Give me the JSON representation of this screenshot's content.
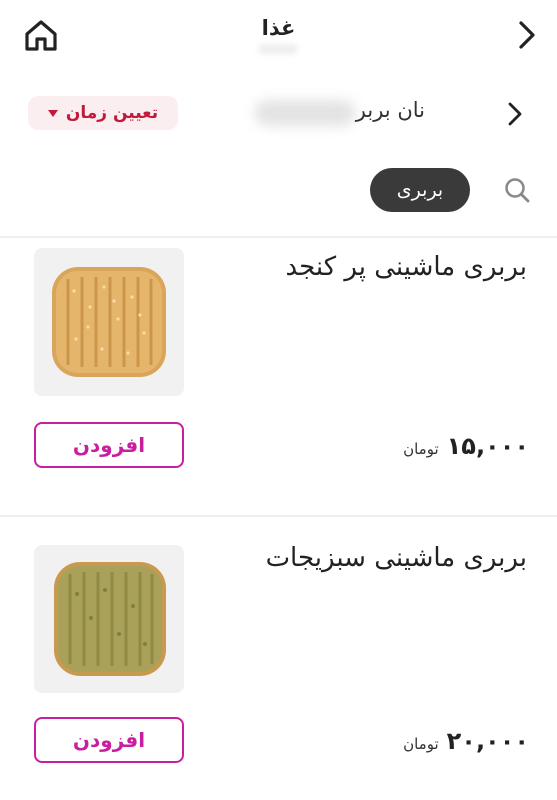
{
  "header": {
    "title": "غذا",
    "home_icon": "home-icon",
    "back_icon": "chevron-right-icon"
  },
  "store": {
    "name": "نان بربر",
    "time_button_label": "تعیین زمان",
    "accent_color": "#c21a3c"
  },
  "search": {
    "icon": "search-icon",
    "active_chip": "بربری"
  },
  "products": [
    {
      "name": "بربری ماشینی پر کنجد",
      "price": "۱۵,۰۰۰",
      "currency": "تومان",
      "add_label": "افزودن",
      "image": "sesame-barbari-bread-image"
    },
    {
      "name": "بربری ماشینی سبزیجات",
      "price": "۲۰,۰۰۰",
      "currency": "تومان",
      "add_label": "افزودن",
      "image": "herb-barbari-bread-image"
    }
  ],
  "colors": {
    "add_button": "#c81fa0",
    "chip_bg": "#3a3a3a"
  }
}
